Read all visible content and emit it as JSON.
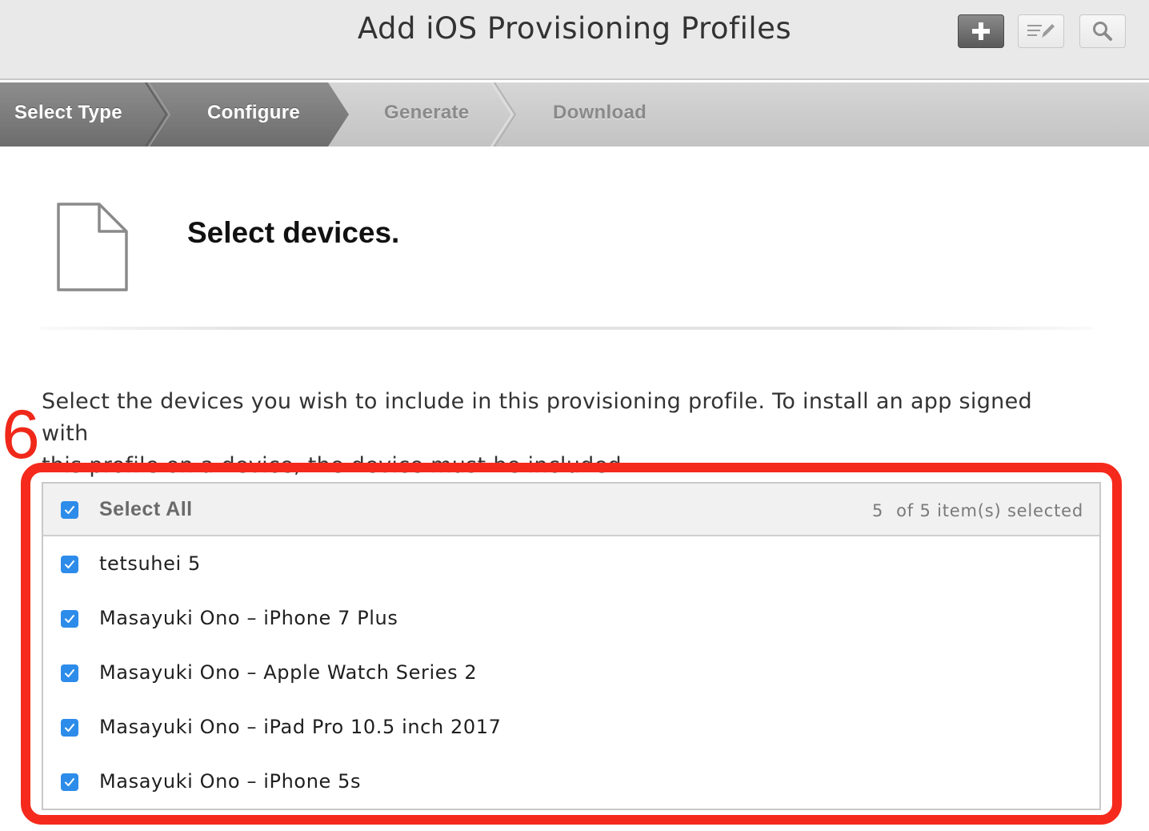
{
  "header": {
    "title": "Add iOS Provisioning Profiles",
    "tools": [
      {
        "name": "add",
        "icon": "plus-icon"
      },
      {
        "name": "edit",
        "icon": "edit-icon"
      },
      {
        "name": "search",
        "icon": "search-icon"
      }
    ]
  },
  "stepper": {
    "steps": [
      {
        "label": "Select Type",
        "state": "completed"
      },
      {
        "label": "Configure",
        "state": "current"
      },
      {
        "label": "Generate",
        "state": "upcoming"
      },
      {
        "label": "Download",
        "state": "upcoming"
      }
    ]
  },
  "section": {
    "icon": "document-icon",
    "title": "Select devices.",
    "description_line1": "Select the devices you wish to include in this provisioning profile. To install an app signed with",
    "description_line2": "this profile on a device, the device must be included."
  },
  "annotation": {
    "number": "6",
    "color": "#f52a1c"
  },
  "device_list": {
    "select_all_label": "Select All",
    "select_all_checked": true,
    "selected_count": "5",
    "selected_suffix": "of 5 item(s) selected",
    "checkbox_color": "#2d8cea",
    "devices": [
      {
        "name": "tetsuhei 5",
        "checked": true
      },
      {
        "name": "Masayuki Ono – iPhone 7 Plus",
        "checked": true
      },
      {
        "name": "Masayuki Ono – Apple Watch Series 2",
        "checked": true
      },
      {
        "name": "Masayuki Ono – iPad Pro 10.5 inch 2017",
        "checked": true
      },
      {
        "name": "Masayuki Ono – iPhone 5s",
        "checked": true
      }
    ]
  }
}
